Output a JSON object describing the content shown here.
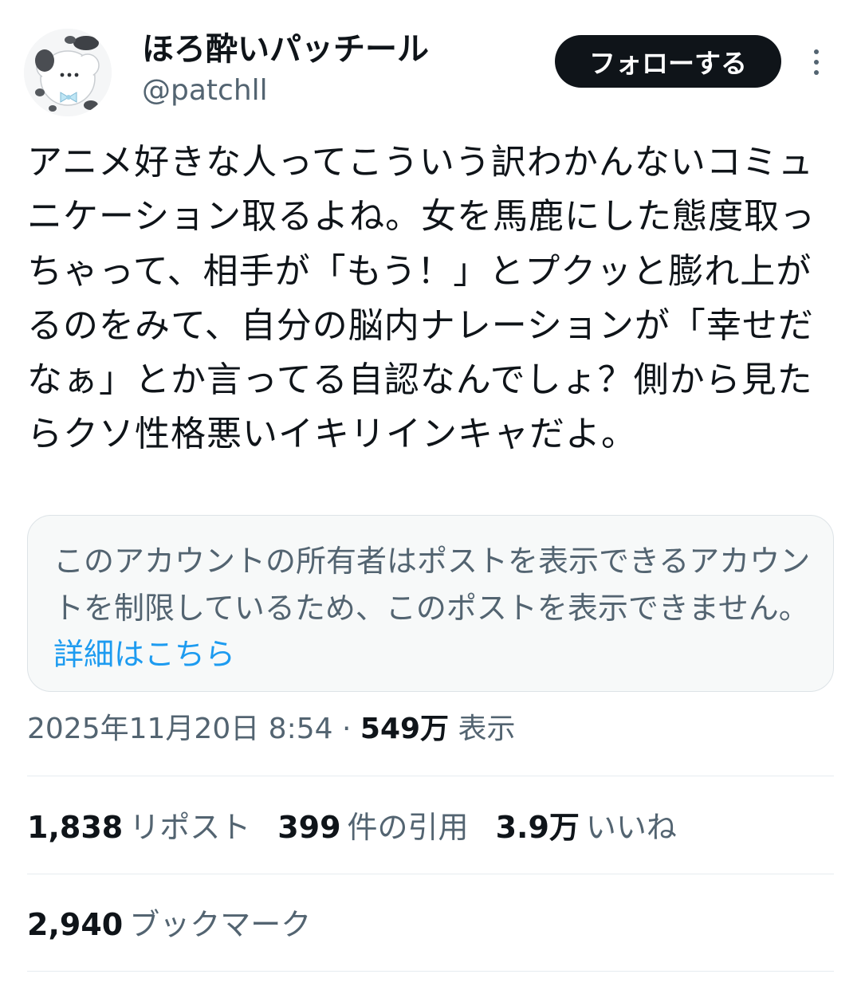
{
  "user": {
    "display_name": "ほろ酔いパッチール",
    "handle": "@patchll",
    "avatar_icon": "spinda-avatar-icon"
  },
  "actions": {
    "follow_label": "フォローする",
    "more_icon": "more-vertical-icon"
  },
  "tweet": {
    "text": "アニメ好きな人ってこういう訳わかんないコミュニケーション取るよね。女を馬鹿にした態度取っちゃって、相手が「もう！」とプクッと膨れ上がるのをみて、自分の脳内ナレーションが「幸せだなぁ」とか言ってる自認なんでしょ？側から見たらクソ性格悪いイキリインキャだよ。"
  },
  "notice": {
    "text": "このアカウントの所有者はポストを表示できるアカウントを制限しているため、このポストを表示できません。",
    "link": "詳細はこちら"
  },
  "meta": {
    "date": "2025年11月20日 8:54",
    "separator": "·",
    "views": "549万",
    "views_label": "表示"
  },
  "stats": {
    "reposts": "1,838",
    "reposts_label": "リポスト",
    "quotes": "399",
    "quotes_label": "件の引用",
    "likes": "3.9万",
    "likes_label": "いいね",
    "bookmarks": "2,940",
    "bookmarks_label": "ブックマーク"
  },
  "colors": {
    "text_primary": "#0f1419",
    "text_secondary": "#536471",
    "link": "#1d9bf0",
    "button_bg": "#0f1419",
    "notice_bg": "#f7f9f9",
    "divider": "#e6ecf0"
  }
}
